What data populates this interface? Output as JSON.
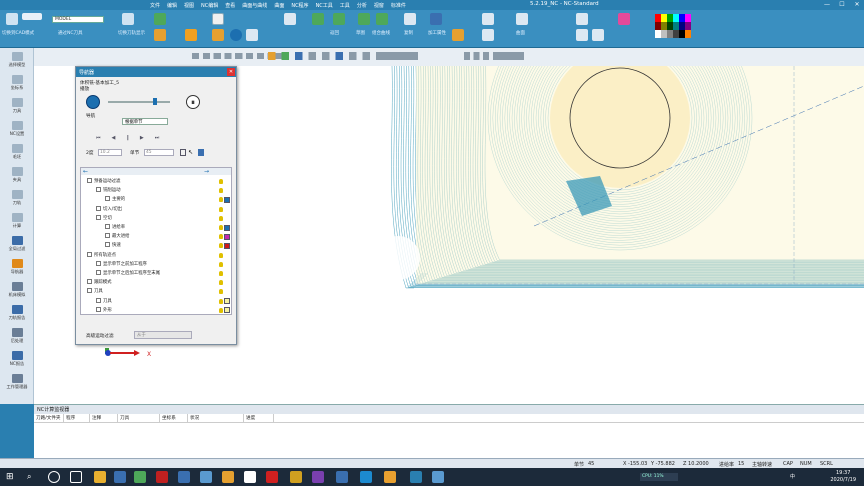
{
  "window": {
    "title": "5.2.19_NC - NC-Standard",
    "menu": [
      "文件",
      "编辑",
      "视图",
      "NC编辑",
      "查看",
      "曲面与曲线",
      "曲面",
      "NC程序",
      "NC工具",
      "工具",
      "分析",
      "视窗",
      "标准件"
    ],
    "min": "—",
    "max": "☐",
    "close": "✕"
  },
  "ribbon": {
    "model_select": "MODEL",
    "labels": [
      "切换到CAD模式",
      "通过NC刀具",
      "切换刀轨显示",
      "加工路径",
      "返回",
      "复制",
      "加工属性",
      "草图",
      "组合曲线",
      "曲面",
      "刀具"
    ]
  },
  "left_dock": {
    "items": [
      {
        "label": "选择模型",
        "icon": "select-model-icon",
        "color": "#9fb3c4"
      },
      {
        "label": "坐标系",
        "icon": "coordinate-icon",
        "color": "#9fb3c4"
      },
      {
        "label": "刀具",
        "icon": "tool-icon",
        "color": "#9fb3c4"
      },
      {
        "label": "NC设置",
        "icon": "nc-setting-icon",
        "color": "#9fb3c4"
      },
      {
        "label": "毛坯",
        "icon": "stock-icon",
        "color": "#9fb3c4"
      },
      {
        "label": "夹具",
        "icon": "fixture-icon",
        "color": "#9fb3c4"
      },
      {
        "label": "刀轨",
        "icon": "toolpath-icon",
        "color": "#9fb3c4"
      },
      {
        "label": "计算",
        "icon": "calc-icon",
        "color": "#9fb3c4"
      },
      {
        "label": "全局过滤",
        "icon": "filter-icon",
        "color": "#3b6ca8"
      },
      {
        "label": "导航器",
        "icon": "navigator-icon",
        "color": "#e08a1a"
      },
      {
        "label": "机床模拟",
        "icon": "machine-sim-icon",
        "color": "#6a7e96"
      },
      {
        "label": "刀轨报告",
        "icon": "report-icon",
        "color": "#3b6ca8"
      },
      {
        "label": "后处理",
        "icon": "post-icon",
        "color": "#6a7e96"
      },
      {
        "label": "NC报告",
        "icon": "nc-report-icon",
        "color": "#3b6ca8"
      },
      {
        "label": "工作管理器",
        "icon": "work-manager-icon",
        "color": "#6a7e96"
      }
    ]
  },
  "navigator": {
    "title": "导航器",
    "close": "✕",
    "path": "体积铣-基本加工_5",
    "play_label": "播放",
    "nav_label": "导航",
    "mode_select": "根据单节",
    "field_2d_label": "2度",
    "field_2d_value": "10.2",
    "step_label": "单节",
    "step_value": "45",
    "tree": [
      {
        "label": "预备运动过滤",
        "indent": 0,
        "sq": ""
      },
      {
        "label": "铣削运动",
        "indent": 1,
        "sq": ""
      },
      {
        "label": "主要的",
        "indent": 2,
        "sq": "#1c6fb0"
      },
      {
        "label": "切入/切出",
        "indent": 1,
        "sq": ""
      },
      {
        "label": "空切",
        "indent": 1,
        "sq": ""
      },
      {
        "label": "进给率",
        "indent": 2,
        "sq": "#1c6fb0"
      },
      {
        "label": "最大进给",
        "indent": 2,
        "sq": "#c42ab0"
      },
      {
        "label": "快速",
        "indent": 2,
        "sq": "#d01a1a"
      },
      {
        "label": "所有轨迹点",
        "indent": 0,
        "sq": ""
      },
      {
        "label": "显示单节之前加工程序",
        "indent": 1,
        "sq": ""
      },
      {
        "label": "显示单节之后加工程序至末尾",
        "indent": 1,
        "sq": ""
      },
      {
        "label": "跟踪模式",
        "indent": 0,
        "sq": ""
      },
      {
        "label": "刀具",
        "indent": 0,
        "sq": ""
      },
      {
        "label": "刀具",
        "indent": 1,
        "sq": "#f4f2a0"
      },
      {
        "label": "外形",
        "indent": 1,
        "sq": "#f4f2a0"
      }
    ],
    "advanced_label": "高级运动过滤",
    "advanced_btn": "从于"
  },
  "canvas": {
    "x_axis_label": "X"
  },
  "monitor": {
    "title": "NC计算监视器",
    "columns": [
      "刀路/文件夹",
      "程序",
      "注释",
      "刀具",
      "坐标系",
      "状况",
      "进度"
    ]
  },
  "status": {
    "step_label": "单节",
    "step_value": "45",
    "x": "X -155.03",
    "y": "Y -75.882",
    "z": "Z 10.2000",
    "feed_label": "进给率",
    "feed_value": "15",
    "spindle": "主轴转速",
    "caps": "CAP",
    "num": "NUM",
    "scrl": "SCRL"
  },
  "taskbar": {
    "time": "19:37",
    "date": "2020/7/19",
    "cpu": "CPU: 11%",
    "lang": "中"
  }
}
